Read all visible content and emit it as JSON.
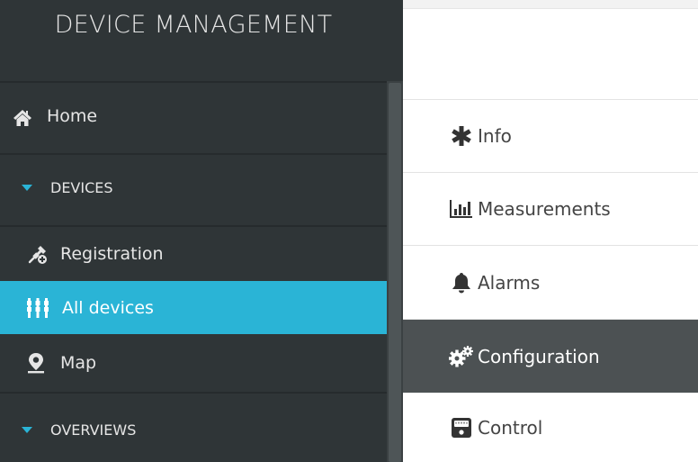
{
  "app": {
    "title": "DEVICE MANAGEMENT"
  },
  "sidebar": {
    "items": [
      {
        "label": "Home",
        "icon": "home-icon"
      },
      {
        "label": "DEVICES",
        "icon": "caret-down-icon"
      },
      {
        "label": "Registration",
        "icon": "satellite-add-icon"
      },
      {
        "label": "All devices",
        "icon": "devices-grid-icon",
        "active": true
      },
      {
        "label": "Map",
        "icon": "map-marker-icon"
      },
      {
        "label": "OVERVIEWS",
        "icon": "caret-down-icon"
      }
    ]
  },
  "tabs": [
    {
      "label": "Info",
      "icon": "asterisk-icon"
    },
    {
      "label": "Measurements",
      "icon": "bar-chart-icon"
    },
    {
      "label": "Alarms",
      "icon": "bell-icon"
    },
    {
      "label": "Configuration",
      "icon": "gears-icon",
      "active": true
    },
    {
      "label": "Control",
      "icon": "control-panel-icon"
    }
  ],
  "colors": {
    "sidebar_bg": "#2f3537",
    "accent": "#2ab4d6",
    "active_tab_bg": "#4c5153",
    "tab_text": "#444444"
  }
}
